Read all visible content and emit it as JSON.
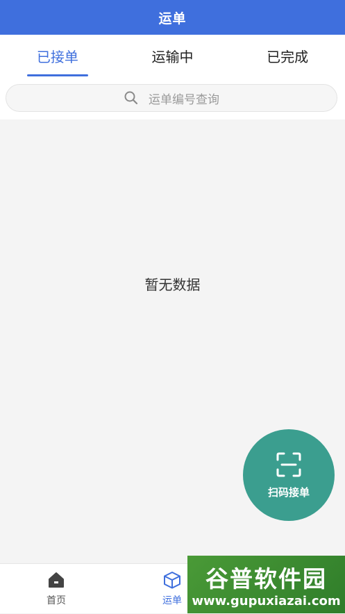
{
  "header": {
    "title": "运单"
  },
  "tabs": [
    {
      "label": "已接单",
      "active": true
    },
    {
      "label": "运输中",
      "active": false
    },
    {
      "label": "已完成",
      "active": false
    }
  ],
  "search": {
    "placeholder": "运单编号查询",
    "icon": "search-icon"
  },
  "main": {
    "empty_text": "暂无数据"
  },
  "fab": {
    "label": "扫码接单",
    "icon": "scan-icon"
  },
  "bottom_nav": {
    "items": [
      {
        "label": "首页",
        "icon": "home-icon",
        "active": false
      },
      {
        "label": "运单",
        "icon": "box-icon",
        "active": true
      }
    ]
  },
  "watermark": {
    "title": "谷普软件园",
    "url": "www.gupuxiazai.com"
  },
  "colors": {
    "primary": "#3f6fdd",
    "fab": "#3b9e8f",
    "background": "#f4f4f4"
  }
}
